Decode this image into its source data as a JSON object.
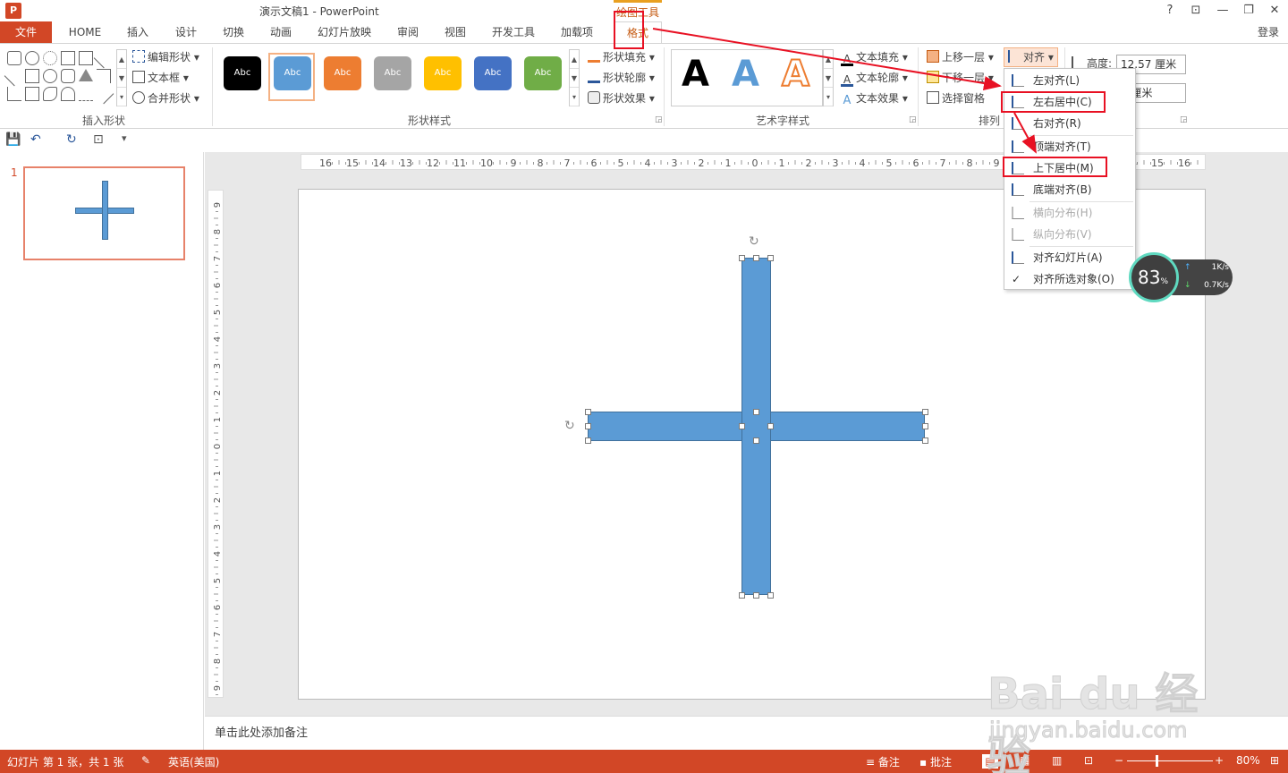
{
  "app": {
    "title": "演示文稿1 - PowerPoint",
    "icon_label": "P"
  },
  "window_controls": {
    "help": "?",
    "ribbon_display": "⊡",
    "minimize": "—",
    "maximize": "❐",
    "close": "✕"
  },
  "contextual_header": "绘图工具",
  "tabs": [
    "文件",
    "HOME",
    "插入",
    "设计",
    "切换",
    "动画",
    "幻灯片放映",
    "审阅",
    "视图",
    "开发工具",
    "加载项",
    "格式"
  ],
  "login": "登录",
  "ribbon": {
    "insert_shapes": {
      "label": "插入形状",
      "edit_shape": "编辑形状",
      "text_box": "文本框",
      "merge_shapes": "合并形状"
    },
    "shape_styles": {
      "label": "形状样式",
      "style_labels": [
        "Abc",
        "Abc",
        "Abc",
        "Abc",
        "Abc",
        "Abc",
        "Abc"
      ],
      "style_colors": [
        "#000000",
        "#5b9bd5",
        "#ed7d31",
        "#a5a5a5",
        "#ffc000",
        "#4472c4",
        "#70ad47"
      ],
      "shape_fill": "形状填充",
      "shape_outline": "形状轮廓",
      "shape_effects": "形状效果"
    },
    "wordart_styles": {
      "label": "艺术字样式",
      "samples": [
        "A",
        "A",
        "A"
      ],
      "text_fill": "文本填充",
      "text_outline": "文本轮廓",
      "text_effects": "文本效果"
    },
    "arrange": {
      "label": "排列",
      "bring_forward": "上移一层",
      "send_backward": "下移一层",
      "selection_pane": "选择窗格",
      "align": "对齐"
    },
    "size": {
      "height_label": "高度:",
      "height_value": "12.57 厘米",
      "width_value": "7 厘米"
    }
  },
  "qat": {
    "save": "💾",
    "undo": "↶",
    "redo": "↻",
    "present": "⊡",
    "customize": "▾"
  },
  "thumbnail": {
    "number": "1"
  },
  "notes_placeholder": "单击此处添加备注",
  "ruler": {
    "h_labels": [
      "16",
      "15",
      "14",
      "13",
      "12",
      "11",
      "10",
      "9",
      "8",
      "7",
      "6",
      "5",
      "4",
      "3",
      "2",
      "1",
      "0",
      "1",
      "2",
      "3",
      "4",
      "5",
      "6",
      "7",
      "8",
      "9",
      "10",
      "11",
      "12",
      "13",
      "14",
      "15",
      "16"
    ],
    "v_labels": [
      "9",
      "8",
      "7",
      "6",
      "5",
      "4",
      "3",
      "2",
      "1",
      "0",
      "1",
      "2",
      "3",
      "4",
      "5",
      "6",
      "7",
      "8",
      "9"
    ]
  },
  "align_menu": {
    "items": [
      {
        "label": "左对齐(L)",
        "enabled": true
      },
      {
        "label": "左右居中(C)",
        "enabled": true
      },
      {
        "label": "右对齐(R)",
        "enabled": true
      },
      {
        "label": "顶端对齐(T)",
        "enabled": true
      },
      {
        "label": "上下居中(M)",
        "enabled": true
      },
      {
        "label": "底端对齐(B)",
        "enabled": true
      },
      {
        "label": "横向分布(H)",
        "enabled": false
      },
      {
        "label": "纵向分布(V)",
        "enabled": false
      },
      {
        "label": "对齐幻灯片(A)",
        "enabled": true
      },
      {
        "label": "对齐所选对象(O)",
        "enabled": true,
        "checked": true
      }
    ]
  },
  "net_widget": {
    "percent": "83",
    "percent_unit": "%",
    "up": "1K/s",
    "down": "0.7K/s"
  },
  "statusbar": {
    "slide_info": "幻灯片 第 1 张，共 1 张",
    "language": "英语(美国)",
    "notes": "备注",
    "comments": "批注",
    "zoom": "80%"
  },
  "watermark": {
    "brand": "Bai du 经验",
    "url": "jingyan.baidu.com"
  },
  "colors": {
    "accent": "#d24726",
    "shape_fill": "#5b9bd5",
    "annotation_red": "#e81123"
  }
}
